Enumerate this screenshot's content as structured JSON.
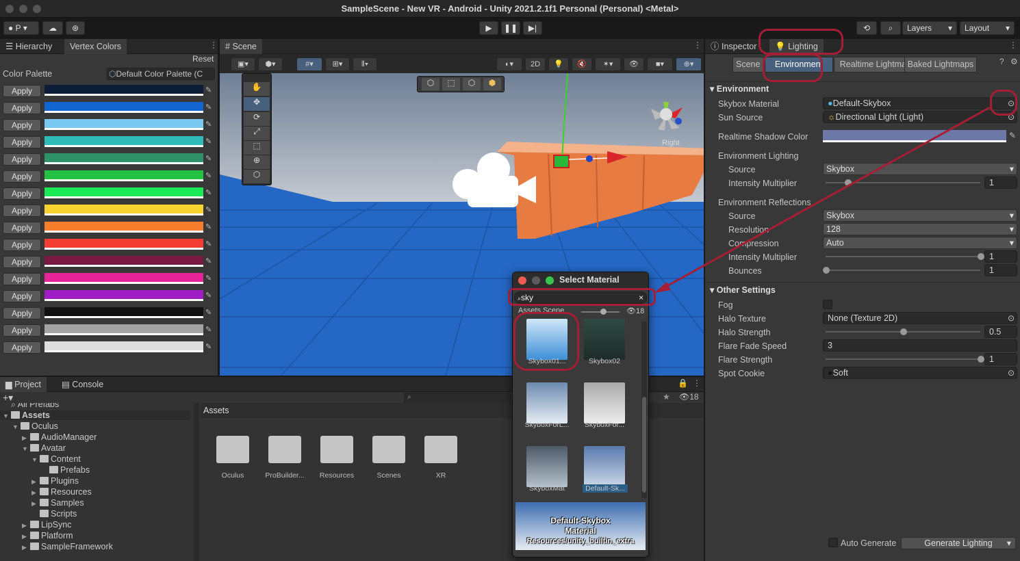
{
  "window": {
    "title": "SampleScene - New VR - Android - Unity 2021.2.1f1 Personal (Personal) <Metal>"
  },
  "toolbar": {
    "account": "P",
    "layers": "Layers",
    "layout": "Layout"
  },
  "hierarchy": {
    "tabs": [
      "Hierarchy",
      "Vertex Colors"
    ],
    "reset": "Reset",
    "palette_label": "Color Palette",
    "palette_value": "Default Color Palette (C",
    "apply_label": "Apply",
    "colors": [
      "#0c1d38",
      "#1264d1",
      "#78c8ef",
      "#2fbcb9",
      "#2f9269",
      "#23c244",
      "#19ea55",
      "#f7d331",
      "#f77e2c",
      "#f23d32",
      "#7b1a41",
      "#e72497",
      "#9f1dc4",
      "#111111",
      "#a3a3a3",
      "#dedede"
    ]
  },
  "scene": {
    "tab": "Scene",
    "mode_2d": "2D",
    "gizmo_label": "Right"
  },
  "project": {
    "tabs": [
      "Project",
      "Console"
    ],
    "search_count": "18",
    "breadcrumb": "Assets",
    "tree": [
      {
        "label": "All Prefabs",
        "depth": 0,
        "arrow": ""
      },
      {
        "label": "Assets",
        "depth": 0,
        "arrow": "open"
      },
      {
        "label": "Oculus",
        "depth": 1,
        "arrow": "open"
      },
      {
        "label": "AudioManager",
        "depth": 2,
        "arrow": "closed"
      },
      {
        "label": "Avatar",
        "depth": 2,
        "arrow": "open"
      },
      {
        "label": "Content",
        "depth": 3,
        "arrow": "open"
      },
      {
        "label": "Prefabs",
        "depth": 4,
        "arrow": ""
      },
      {
        "label": "Plugins",
        "depth": 3,
        "arrow": "closed"
      },
      {
        "label": "Resources",
        "depth": 3,
        "arrow": "closed"
      },
      {
        "label": "Samples",
        "depth": 3,
        "arrow": "closed"
      },
      {
        "label": "Scripts",
        "depth": 3,
        "arrow": ""
      },
      {
        "label": "LipSync",
        "depth": 2,
        "arrow": "closed"
      },
      {
        "label": "Platform",
        "depth": 2,
        "arrow": "closed"
      },
      {
        "label": "SampleFramework",
        "depth": 2,
        "arrow": "closed"
      }
    ],
    "folders": [
      "Oculus",
      "ProBuilder...",
      "Resources",
      "Scenes",
      "XR"
    ]
  },
  "select_material": {
    "title": "Select Material",
    "search_value": "sky",
    "tabs_text": "Assets  Scene",
    "count": "18",
    "items": [
      {
        "label": "Skybox01...",
        "color_top": "#cfe7f8",
        "color_bottom": "#3d8fd6"
      },
      {
        "label": "Skybox02",
        "color_top": "#2f4b43",
        "color_bottom": "#1e2c29"
      },
      {
        "label": "SkyboxForL...",
        "color_top": "#6c8bb0",
        "color_bottom": "#e6ecf3"
      },
      {
        "label": "SkyboxFor...",
        "color_top": "#a9a9a9",
        "color_bottom": "#eeeeee"
      },
      {
        "label": "SkyboxMat",
        "color_top": "#4d5966",
        "color_bottom": "#b4c0cc"
      },
      {
        "label": "Default-Sk...",
        "color_top": "#5a79ad",
        "color_bottom": "#ccd9e8"
      }
    ],
    "preview_line1": "Default-Skybox",
    "preview_line2": "Material",
    "preview_line3": "Resources/unity_builtin_extra"
  },
  "inspector": {
    "tabs": [
      "Inspector",
      "Lighting"
    ],
    "subtabs": [
      "Scene",
      "Environment",
      "Realtime Lightmaps",
      "Baked Lightmaps"
    ],
    "environment_header": "Environment",
    "skybox_label": "Skybox Material",
    "skybox_value": "Default-Skybox",
    "sun_label": "Sun Source",
    "sun_value": "Directional Light (Light)",
    "shadow_color_label": "Realtime Shadow Color",
    "shadow_color": "#6c78a6",
    "env_lighting_label": "Environment Lighting",
    "source_label": "Source",
    "env_source_value": "Skybox",
    "intensity_label": "Intensity Multiplier",
    "env_intensity_value": "1",
    "env_intensity_level": 0.14,
    "env_reflections_label": "Environment Reflections",
    "refl_source_value": "Skybox",
    "resolution_label": "Resolution",
    "resolution_value": "128",
    "compression_label": "Compression",
    "compression_value": "Auto",
    "refl_intensity_value": "1",
    "refl_intensity_level": 1.0,
    "bounces_label": "Bounces",
    "bounces_value": "1",
    "bounces_level": 0.0,
    "other_header": "Other Settings",
    "fog_label": "Fog",
    "halo_texture_label": "Halo Texture",
    "halo_texture_value": "None (Texture 2D)",
    "halo_strength_label": "Halo Strength",
    "halo_strength_value": "0.5",
    "halo_strength_level": 0.5,
    "flare_fade_label": "Flare Fade Speed",
    "flare_fade_value": "3",
    "flare_strength_label": "Flare Strength",
    "flare_strength_value": "1",
    "flare_strength_level": 1.0,
    "spot_cookie_label": "Spot Cookie",
    "spot_cookie_value": "Soft",
    "auto_generate_label": "Auto Generate",
    "generate_button": "Generate Lighting"
  }
}
